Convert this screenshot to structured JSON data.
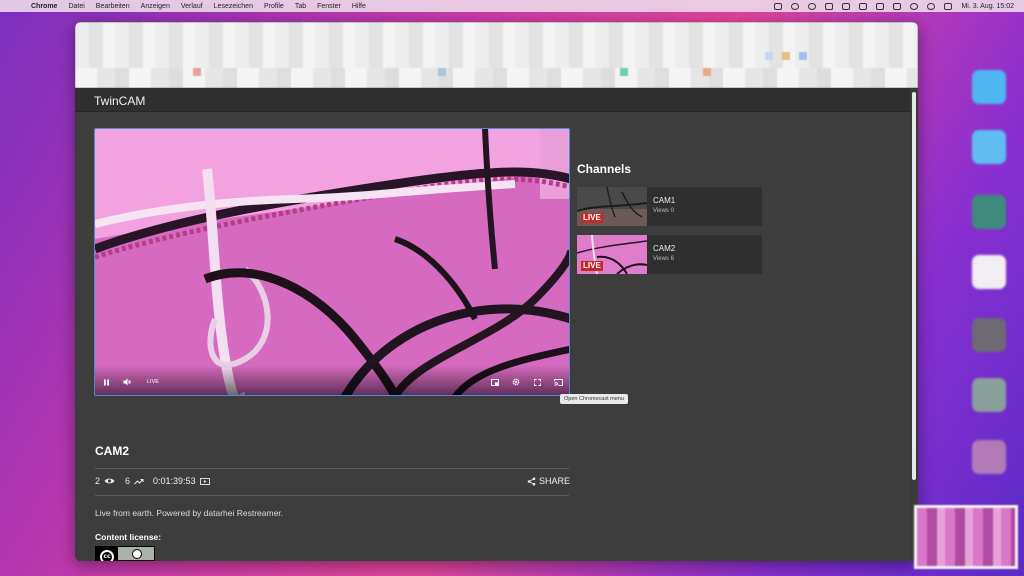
{
  "menubar": {
    "app_name": "Chrome",
    "items": [
      "Datei",
      "Bearbeiten",
      "Anzeigen",
      "Verlauf",
      "Lesezeichen",
      "Profile",
      "Tab",
      "Fenster",
      "Hilfe"
    ],
    "clock": "Mi. 3. Aug.  15:02"
  },
  "app": {
    "title": "TwinCAM"
  },
  "player": {
    "live_label": "LIVE",
    "tooltip": "Open Chromecast menu"
  },
  "channels": {
    "heading": "Channels",
    "items": [
      {
        "name": "CAM1",
        "views": "Views 0",
        "badge": "LIVE"
      },
      {
        "name": "CAM2",
        "views": "Views 6",
        "badge": "LIVE"
      }
    ]
  },
  "stream": {
    "title": "CAM2",
    "viewers": "2",
    "total_views": "6",
    "uptime": "0:01:39:53",
    "share_label": "SHARE",
    "description": "Live from earth. Powered by datarhei Restreamer.",
    "license_label": "Content license:",
    "license_badge_text": "BY"
  },
  "colors": {
    "accent": "#4a8cdb",
    "live": "#c62828",
    "background": "#3d3d3d"
  }
}
